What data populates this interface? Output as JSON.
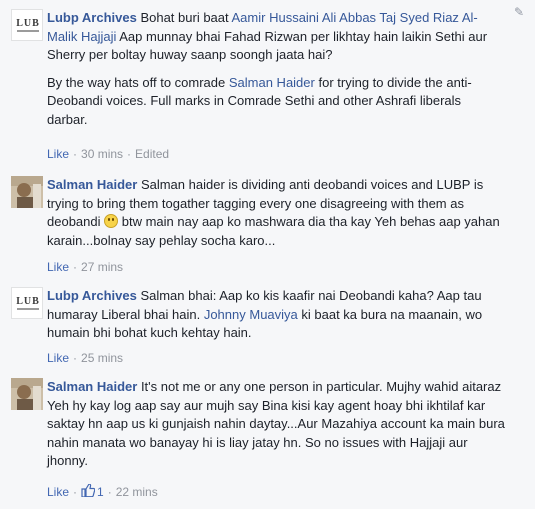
{
  "comments": [
    {
      "author": "Lubp Archives",
      "avatar_text": "LUB",
      "paragraphs": [
        {
          "parts": [
            {
              "type": "author",
              "text": "Lubp Archives"
            },
            {
              "type": "text",
              "text": " Bohat buri baat "
            },
            {
              "type": "tag",
              "text": "Aamir Hussaini"
            },
            {
              "type": "text",
              "text": " "
            },
            {
              "type": "tag",
              "text": "Ali Abbas Taj"
            },
            {
              "type": "text",
              "text": " "
            },
            {
              "type": "tag",
              "text": "Syed Riaz Al-Malik Hajjaji"
            },
            {
              "type": "text",
              "text": " Aap munnay bhai Fahad Rizwan per likhtay hain laikin Sethi aur Sherry per boltay huway saanp soongh jaata hai?"
            }
          ]
        },
        {
          "parts": [
            {
              "type": "text",
              "text": "By the way hats off to comrade "
            },
            {
              "type": "tag",
              "text": "Salman Haider"
            },
            {
              "type": "text",
              "text": " for trying to divide the anti-Deobandi voices. Full marks in Comrade Sethi and other Ashrafi liberals darbar."
            }
          ]
        }
      ],
      "meta": {
        "like": "Like",
        "time": "30 mins",
        "edited": "Edited",
        "likes_count": ""
      }
    },
    {
      "author": "Salman Haider",
      "avatar_text": "",
      "paragraphs": [
        {
          "parts": [
            {
              "type": "author",
              "text": "Salman Haider"
            },
            {
              "type": "text",
              "text": " Salman haider is dividing anti deobandi voices and LUBP is trying to bring them togather tagging every one disagreeing with them as deobandi "
            },
            {
              "type": "emoji",
              "text": ""
            },
            {
              "type": "text",
              "text": " btw main nay aap ko mashwara dia tha kay Yeh behas aap yahan karain...bolnay say pehlay socha karo..."
            }
          ]
        }
      ],
      "meta": {
        "like": "Like",
        "time": "27 mins",
        "edited": "",
        "likes_count": ""
      }
    },
    {
      "author": "Lubp Archives",
      "avatar_text": "LUB",
      "paragraphs": [
        {
          "parts": [
            {
              "type": "author",
              "text": "Lubp Archives"
            },
            {
              "type": "text",
              "text": " Salman bhai: Aap ko kis kaafir nai Deobandi kaha? Aap tau humaray Liberal bhai hain. "
            },
            {
              "type": "tag",
              "text": "Johnny Muaviya"
            },
            {
              "type": "text",
              "text": " ki baat ka bura na maanain, wo humain bhi bohat kuch kehtay hain."
            }
          ]
        }
      ],
      "meta": {
        "like": "Like",
        "time": "25 mins",
        "edited": "",
        "likes_count": ""
      }
    },
    {
      "author": "Salman Haider",
      "avatar_text": "",
      "paragraphs": [
        {
          "parts": [
            {
              "type": "author",
              "text": "Salman Haider"
            },
            {
              "type": "text",
              "text": " It's not me or any one person in particular. Mujhy wahid aitaraz Yeh hy kay log aap say aur mujh say Bina kisi kay agent hoay bhi ikhtilaf kar saktay hn aap us ki gunjaish nahin daytay...Aur Mazahiya account ka main bura nahin manata wo banayay hi is liay jatay hn. So no issues with Hajjaji aur jhonny."
            }
          ]
        }
      ],
      "meta": {
        "like": "Like",
        "time": "22 mins",
        "edited": "",
        "likes_count": "1"
      }
    }
  ],
  "icons": {
    "edit": "pencil-icon",
    "like_thumb": "thumbs-up-icon",
    "emoji": "smiley-emoji-icon"
  }
}
